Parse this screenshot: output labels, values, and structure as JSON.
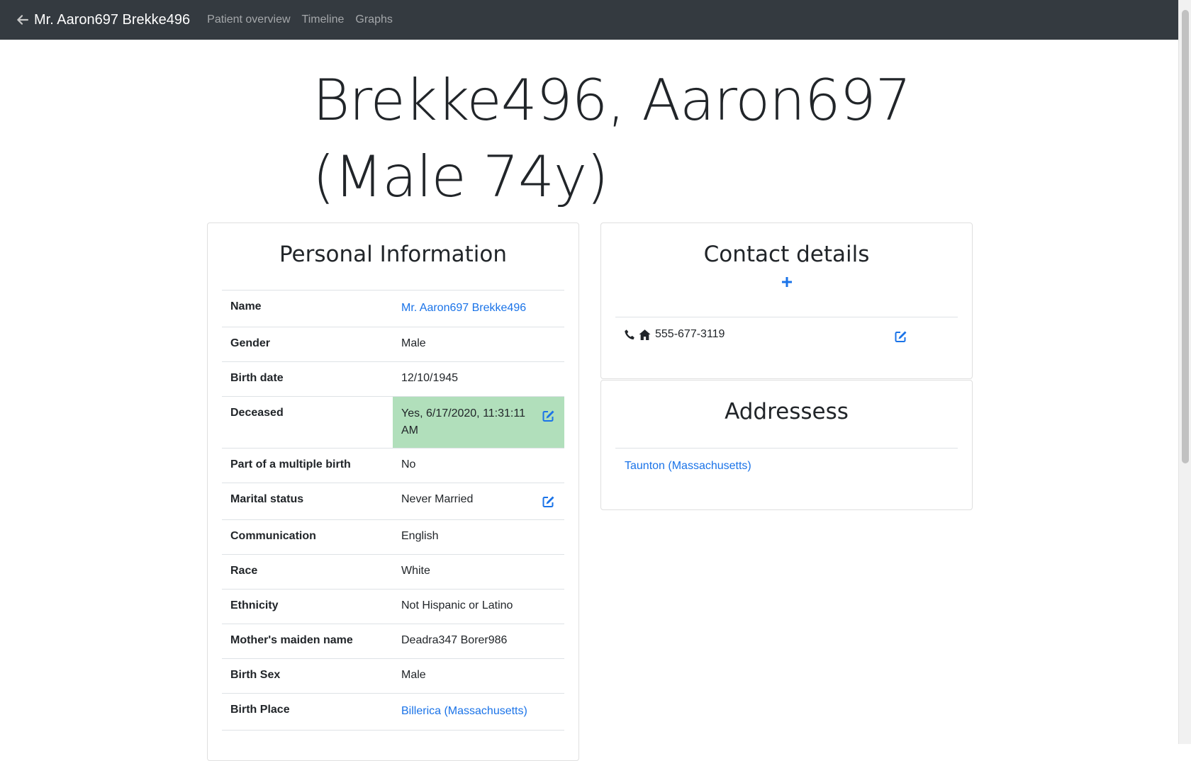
{
  "navbar": {
    "brand": "Mr. Aaron697 Brekke496",
    "links": [
      "Patient overview",
      "Timeline",
      "Graphs"
    ]
  },
  "page": {
    "title_line1": "Brekke496, Aaron697",
    "title_line2": "(Male 74y)"
  },
  "personal": {
    "title": "Personal Information",
    "rows": [
      {
        "label": "Name",
        "value": "Mr. Aaron697 Brekke496"
      },
      {
        "label": "Gender",
        "value": "Male"
      },
      {
        "label": "Birth date",
        "value": "12/10/1945"
      },
      {
        "label": "Deceased",
        "value": "Yes, 6/17/2020, 11:31:11 AM"
      },
      {
        "label": "Part of a multiple birth",
        "value": "No"
      },
      {
        "label": "Marital status",
        "value": "Never Married"
      },
      {
        "label": "Communication",
        "value": "English"
      },
      {
        "label": "Race",
        "value": "White"
      },
      {
        "label": "Ethnicity",
        "value": "Not Hispanic or Latino"
      },
      {
        "label": "Mother's maiden name",
        "value": "Deadra347 Borer986"
      },
      {
        "label": "Birth Sex",
        "value": "Male"
      },
      {
        "label": "Birth Place",
        "value": "Billerica (Massachusetts)"
      }
    ]
  },
  "contact": {
    "title": "Contact details",
    "phone": "555-677-3119"
  },
  "addresses": {
    "title": "Addressess",
    "items": [
      "Taunton (Massachusetts)"
    ]
  },
  "colors": {
    "navbar_bg": "#343a40",
    "link": "#1a73e8",
    "deceased_bg": "#b1dfbb"
  }
}
